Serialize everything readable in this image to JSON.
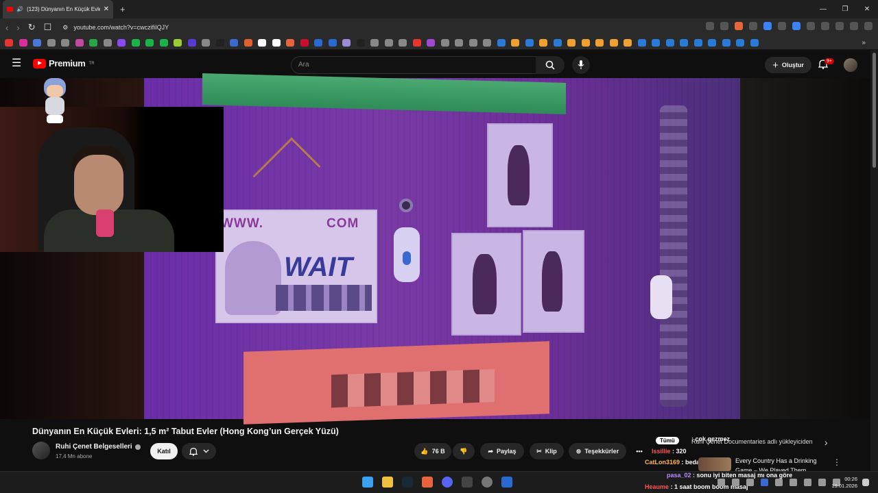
{
  "browser": {
    "tab_title": "(123) Dünyanın En Küçük Evleri: 1,5 m² Tabut Evler (Hong Kong'un Gerçek Yüzü)",
    "tab_title_visible": "(123) Dünyanın En Küçük Evle",
    "url": "youtube.com/watch?v=cwczifiIQJY",
    "new_tab": "+",
    "window_controls": [
      "—",
      "❐",
      "✕"
    ]
  },
  "bookmarks_colors": [
    "#e6352f",
    "#d6309a",
    "#4a78d8",
    "#888",
    "#888",
    "#c04aa0",
    "#2aa44a",
    "#888",
    "#8a4af0",
    "#19b34a",
    "#19b34a",
    "#19b34a",
    "#9acd32",
    "#5a3ad0",
    "#888",
    "#222",
    "#3a6ad0",
    "#e06030",
    "#fff",
    "#fff",
    "#e8643c",
    "#c8102e",
    "#2a6ad0",
    "#2a6ad0",
    "#9a8ad8",
    "#222",
    "#888",
    "#888",
    "#888",
    "#e6352f",
    "#a04ad0",
    "#888",
    "#888",
    "#888",
    "#888",
    "#2a7ad8",
    "#f0a030",
    "#2a7ad8",
    "#f0a030",
    "#2a7ad8",
    "#f0a030",
    "#f0a030",
    "#f0a030",
    "#f0a030",
    "#f0a030",
    "#2a7ad8",
    "#2a7ad8",
    "#2a7ad8",
    "#2a7ad8",
    "#2a7ad8",
    "#2a7ad8",
    "#2a7ad8",
    "#2a7ad8",
    "#2a7ad8"
  ],
  "youtube": {
    "logo_text": "Premium",
    "region": "TR",
    "search_placeholder": "Ara",
    "create_label": "Oluştur",
    "notif_badge": "9+"
  },
  "video": {
    "title": "Dünyanın En Küçük Evleri: 1,5 m² Tabut Evler (Hong Kong’un Gerçek Yüzü)",
    "sign_url": "WWW.",
    "sign_url_end": "COM",
    "sign_word": "WAIT"
  },
  "channel": {
    "name": "Ruhi Çenet Belgeselleri",
    "subs": "17,4 Mn abone",
    "join_label": "Katıl"
  },
  "actions": {
    "likes": "76 B",
    "share": "Paylaş",
    "clip": "Klip",
    "thanks": "Teşekkürler",
    "more": "•••"
  },
  "chat": [
    {
      "user": "",
      "text": ": çok gezmez"
    },
    {
      "user": "",
      "text": "Ruhi Çenet Documentaries adlı yükleyiciden"
    },
    {
      "user": "Issillie",
      "text": ": 320"
    },
    {
      "user": "CatLon3169",
      "text": ": bedava aq"
    },
    {
      "user": "pasa_02",
      "text": ": sonu iyi biten masaj mı ona göre"
    },
    {
      "user": "Heaume",
      "text": ": 1 saat boom boom masaj"
    }
  ],
  "chat_tooltip": "Tümü",
  "next_card": {
    "line1": "Every Country Has a Drinking",
    "line2": "Game – We Played Them"
  },
  "taskbar": {
    "time": "00:26",
    "date": "19.01.2026"
  }
}
